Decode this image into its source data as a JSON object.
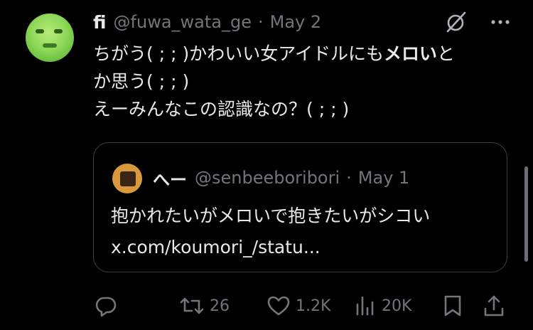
{
  "tweet": {
    "display_name": "fi",
    "handle": "@fuwa_wata_ge",
    "separator": "·",
    "date": "May 2",
    "text_lines": [
      "ちがう( ; ; )かわいい女アイドルにも",
      "メロい",
      "と",
      "か思う( ; ; )",
      "えーみんなこの認識なの？( ; ; )"
    ]
  },
  "quote": {
    "display_name": "へー",
    "handle": "@senbeeboribori",
    "separator": "·",
    "date": "May 1",
    "text_lines": [
      "抱かれたいがメロいで抱きたいがシコい",
      "x.com/koumori_/statu..."
    ]
  },
  "actions": {
    "reply_count": "",
    "retweet_count": "26",
    "like_count": "1.2K",
    "views_count": "20K"
  },
  "icons": {
    "grok": "grok-icon",
    "more": "more-icon",
    "reply": "reply-icon",
    "retweet": "retweet-icon",
    "like": "like-icon",
    "views": "views-icon",
    "bookmark": "bookmark-icon",
    "share": "share-icon"
  },
  "colors": {
    "background": "#000000",
    "text": "#e7e9ea",
    "secondary": "#71767b",
    "border": "#3a3f44"
  }
}
